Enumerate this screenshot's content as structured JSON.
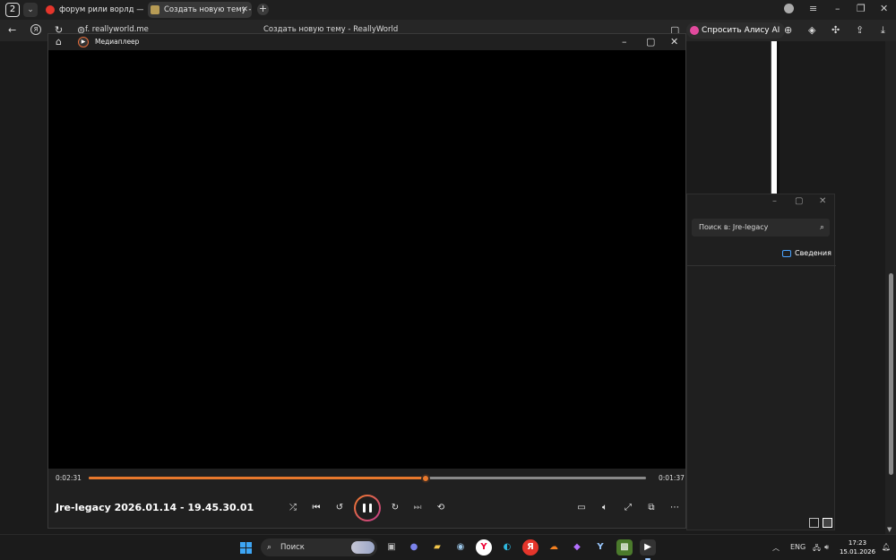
{
  "browser": {
    "tab_count": "2",
    "tabs": [
      {
        "label": "форум рили ворлд — Янд",
        "close": ""
      },
      {
        "label": "Создать новую тему - R",
        "close": "✕"
      }
    ],
    "url": "f. reallyworld.me",
    "page_title": "Создать новую тему - ReallyWorld",
    "alice_label": "Спросить Алису AI"
  },
  "explorer": {
    "search_placeholder": "Поиск в: Jre-legacy",
    "details_label": "Сведения"
  },
  "player": {
    "app_title": "Медиаплеер",
    "elapsed": "0:02:31",
    "remaining": "0:01:37",
    "progress_fraction": 0.605,
    "track_title": "Jre-legacy 2026.01.14 - 19.45.30.01",
    "accent_color": "#e8782c"
  },
  "taskbar": {
    "search_label": "Поиск",
    "language": "ENG",
    "time": "17:23",
    "date": "15.01.2026",
    "yandex_letter": "Я"
  }
}
